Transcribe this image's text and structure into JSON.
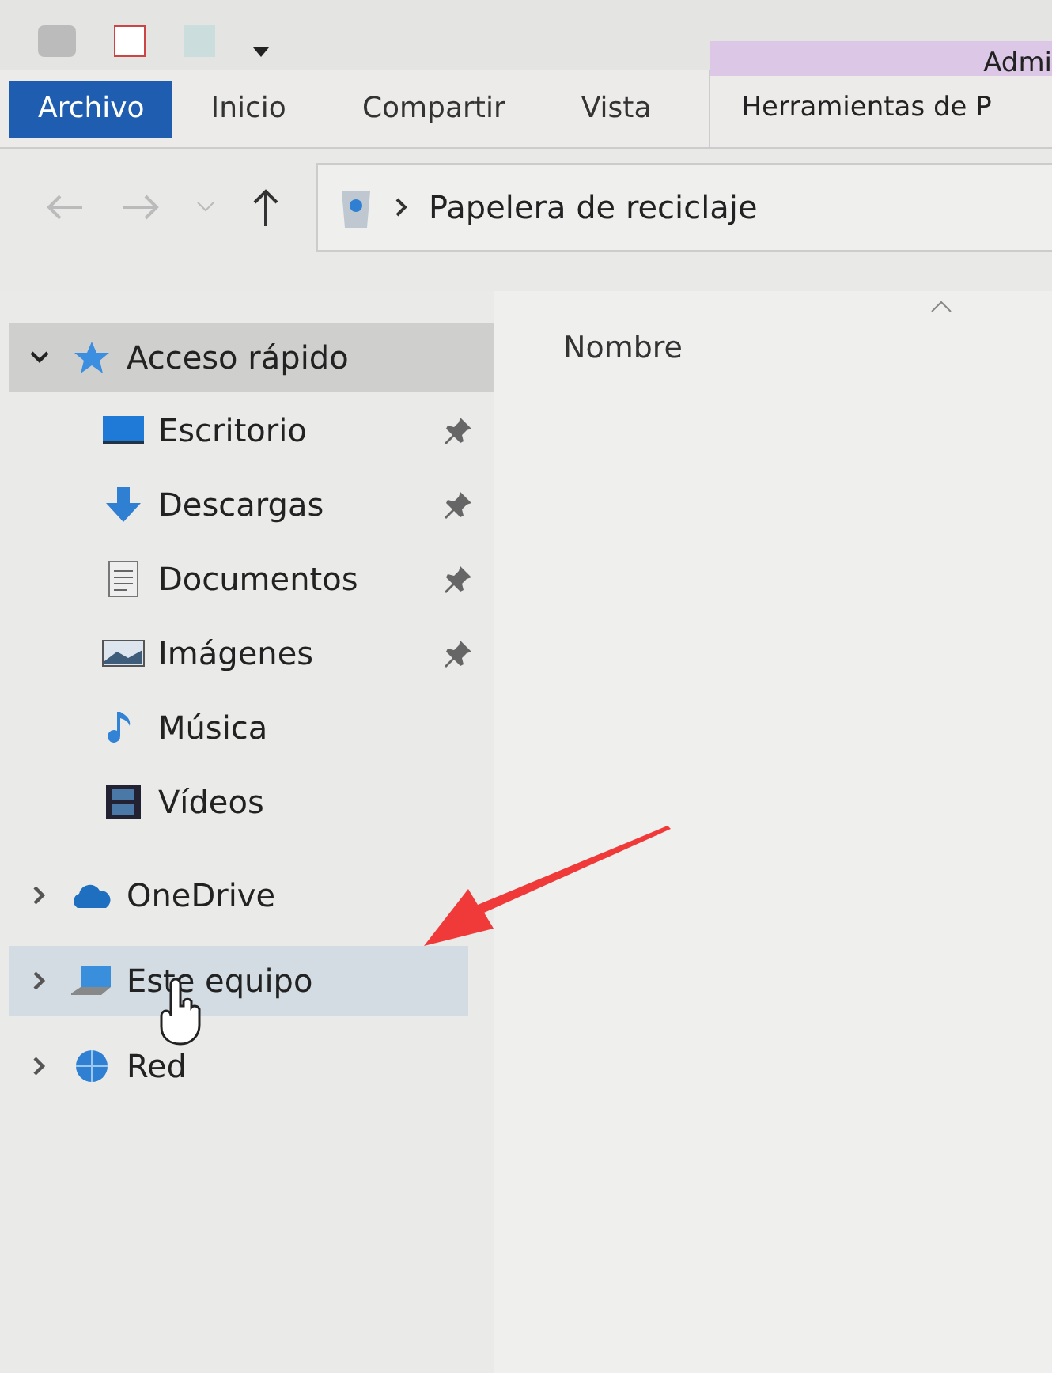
{
  "ribbon": {
    "tabs": [
      {
        "label": "Archivo",
        "kind": "file"
      },
      {
        "label": "Inicio",
        "kind": "tab"
      },
      {
        "label": "Compartir",
        "kind": "tab"
      },
      {
        "label": "Vista",
        "kind": "tab"
      }
    ],
    "contextual": {
      "group": "Admi",
      "tab": "Herramientas de P"
    }
  },
  "address_bar": {
    "path": "Papelera de reciclaje"
  },
  "navigation": [
    {
      "label": "Acceso rápido",
      "kind": "star",
      "expanded": true,
      "selected": true,
      "hovered": false,
      "children": [
        {
          "label": "Escritorio",
          "kind": "desktop",
          "pinned": true
        },
        {
          "label": "Descargas",
          "kind": "download",
          "pinned": true
        },
        {
          "label": "Documentos",
          "kind": "document",
          "pinned": true
        },
        {
          "label": "Imágenes",
          "kind": "pictures",
          "pinned": true
        },
        {
          "label": "Música",
          "kind": "music",
          "pinned": false
        },
        {
          "label": "Vídeos",
          "kind": "video",
          "pinned": false
        }
      ]
    },
    {
      "label": "OneDrive",
      "kind": "cloud",
      "expanded": false,
      "selected": false,
      "hovered": false
    },
    {
      "label": "Este equipo",
      "kind": "computer",
      "expanded": false,
      "selected": false,
      "hovered": true
    },
    {
      "label": "Red",
      "kind": "network",
      "expanded": false,
      "selected": false,
      "hovered": false
    }
  ],
  "file_list": {
    "columns": [
      {
        "label": "Nombre",
        "sorted": true
      }
    ]
  }
}
